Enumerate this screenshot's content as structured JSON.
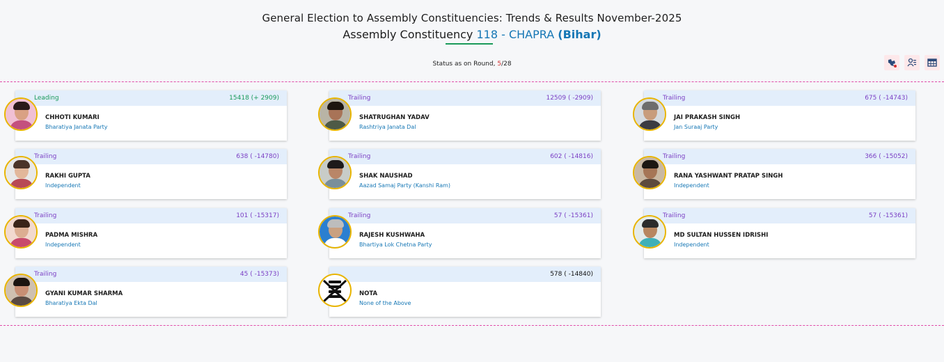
{
  "header": {
    "title_line1": "General Election to Assembly Constituencies: Trends & Results November-2025",
    "title_prefix": "Assembly Constituency",
    "ac_number": "118",
    "ac_name": "- CHAPRA",
    "state": "(Bihar)"
  },
  "status": {
    "prefix": "Status as on Round,",
    "current_round": "5",
    "total_rounds": "/28"
  },
  "toolbar": {
    "icons": [
      "map-view-icon",
      "candidate-list-icon",
      "table-view-icon"
    ]
  },
  "colors": {
    "leading": "#1a9a5a",
    "trailing": "#7b3fc4",
    "party_link": "#1677b5",
    "photo_ring": "#e8b400",
    "separator": "#e04aa8"
  },
  "candidates": [
    {
      "status": "Leading",
      "votes": "15418 (+ 2909)",
      "name": "CHHOTI KUMARI",
      "party": "Bharatiya Janata Party"
    },
    {
      "status": "Trailing",
      "votes": "12509 ( -2909)",
      "name": "SHATRUGHAN YADAV",
      "party": "Rashtriya Janata Dal"
    },
    {
      "status": "Trailing",
      "votes": "675 ( -14743)",
      "name": "JAI PRAKASH SINGH",
      "party": "Jan Suraaj Party"
    },
    {
      "status": "Trailing",
      "votes": "638 ( -14780)",
      "name": "RAKHI GUPTA",
      "party": "Independent"
    },
    {
      "status": "Trailing",
      "votes": "602 ( -14816)",
      "name": "SHAK NAUSHAD",
      "party": "Aazad Samaj Party (Kanshi Ram)"
    },
    {
      "status": "Trailing",
      "votes": "366 ( -15052)",
      "name": "RANA YASHWANT PRATAP SINGH",
      "party": "Independent"
    },
    {
      "status": "Trailing",
      "votes": "101 ( -15317)",
      "name": "PADMA MISHRA",
      "party": "Independent"
    },
    {
      "status": "Trailing",
      "votes": "57 ( -15361)",
      "name": "RAJESH KUSHWAHA",
      "party": "Bhartiya Lok Chetna Party"
    },
    {
      "status": "Trailing",
      "votes": "57 ( -15361)",
      "name": "MD SULTAN HUSSEN IDRISHI",
      "party": "Independent"
    },
    {
      "status": "Trailing",
      "votes": "45 ( -15373)",
      "name": "GYANI KUMAR SHARMA",
      "party": "Bharatiya Ekta Dal"
    },
    {
      "status": "",
      "votes": "578 ( -14840)",
      "name": "NOTA",
      "party": "None of the Above"
    }
  ]
}
